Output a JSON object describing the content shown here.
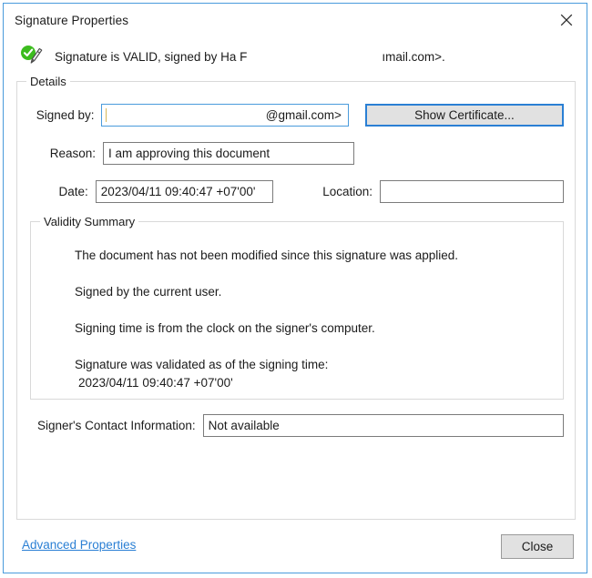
{
  "window": {
    "title": "Signature Properties",
    "close_icon": "close-icon"
  },
  "status": {
    "icon": "signature-valid-icon",
    "text_before": "Signature is VALID, signed by Ha F",
    "text_after": "ımail.com>."
  },
  "details": {
    "legend": "Details",
    "signed_by": {
      "label": "Signed by:",
      "value": "@gmail.com>"
    },
    "show_certificate": {
      "label": "Show Certificate..."
    },
    "reason": {
      "label": "Reason:",
      "value": "I am approving this document"
    },
    "date": {
      "label": "Date:",
      "value": "2023/04/11 09:40:47 +07'00'"
    },
    "location": {
      "label": "Location:",
      "value": ""
    }
  },
  "validity_summary": {
    "legend": "Validity Summary",
    "lines": [
      "The document has not been modified since this signature was applied.",
      "Signed by the current user.",
      "Signing time is from the clock on the signer's computer.",
      "Signature was validated as of the signing time:"
    ],
    "validated_time": "2023/04/11 09:40:47 +07'00'"
  },
  "contact": {
    "label": "Signer's Contact Information:",
    "value": "Not available"
  },
  "footer": {
    "advanced_properties": "Advanced Properties",
    "close": "Close"
  },
  "colors": {
    "dialog_border": "#4a9bdc",
    "accent_blue": "#2a7fd4",
    "link_blue": "#2a7fd4",
    "valid_green": "#3cbc1e",
    "button_face": "#e1e1e1",
    "field_border": "#7b7b7b",
    "group_border": "#d9d9d9",
    "text": "#1b1b1b"
  }
}
